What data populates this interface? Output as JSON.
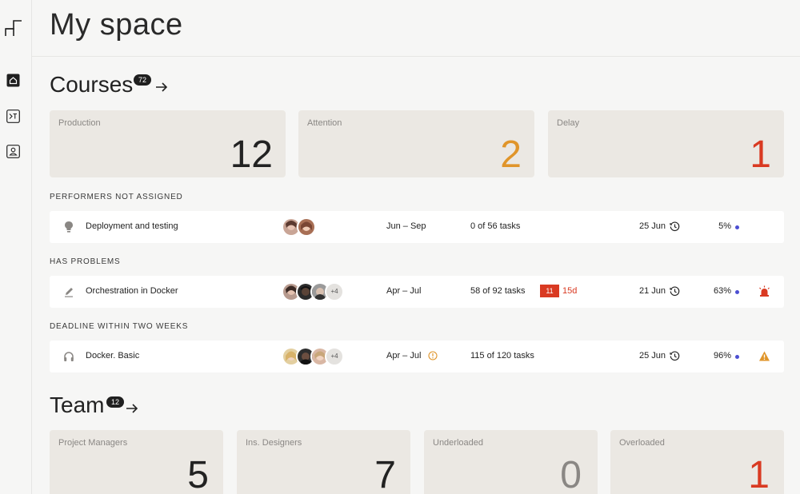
{
  "header": {
    "title": "My space"
  },
  "sidebar": {
    "items": [
      {
        "icon": "home-icon",
        "active": true
      },
      {
        "icon": "courses-icon",
        "active": false
      },
      {
        "icon": "profile-icon",
        "active": false
      }
    ]
  },
  "courses": {
    "title": "Courses",
    "count": "72",
    "stats": [
      {
        "label": "Production",
        "value": "12",
        "color": "#222222"
      },
      {
        "label": "Attention",
        "value": "2",
        "color": "#e0952a"
      },
      {
        "label": "Delay",
        "value": "1",
        "color": "#d93a22"
      }
    ],
    "groups": [
      {
        "label": "PERFORMERS NOT ASSIGNED",
        "rows": [
          {
            "icon": "lightbulb-icon",
            "title": "Deployment and testing",
            "more": "",
            "dates": "Jun – Sep",
            "tasks": "0 of 56 tasks",
            "overdue_count": "",
            "overdue_days": "",
            "due": "25 Jun",
            "percent": "5%",
            "alert": ""
          }
        ]
      },
      {
        "label": "HAS PROBLEMS",
        "rows": [
          {
            "icon": "pencil-icon",
            "title": "Orchestration in Docker",
            "more": "+4",
            "dates": "Apr – Jul",
            "tasks": "58 of 92 tasks",
            "overdue_count": "11",
            "overdue_days": "15d",
            "due": "21 Jun",
            "percent": "63%",
            "alert": "siren-icon"
          }
        ]
      },
      {
        "label": "DEADLINE WITHIN TWO WEEKS",
        "rows": [
          {
            "icon": "headphones-icon",
            "title": "Docker. Basic",
            "more": "+4",
            "dates": "Apr – Jul",
            "tasks": "115 of 120 tasks",
            "overdue_count": "",
            "overdue_days": "",
            "due": "25 Jun",
            "percent": "96%",
            "alert": "warning-icon"
          }
        ]
      }
    ]
  },
  "team": {
    "title": "Team",
    "count": "12",
    "stats": [
      {
        "label": "Project Managers",
        "value": "5",
        "color": "#222222"
      },
      {
        "label": "Ins. Designers",
        "value": "7",
        "color": "#222222"
      },
      {
        "label": "Underloaded",
        "value": "0",
        "color": "#8a8784"
      },
      {
        "label": "Overloaded",
        "value": "1",
        "color": "#d93a22"
      }
    ]
  },
  "colors": {
    "accent": "#4c4fd2",
    "danger": "#d93a22",
    "warning": "#e0952a",
    "card": "#ebe8e3"
  }
}
